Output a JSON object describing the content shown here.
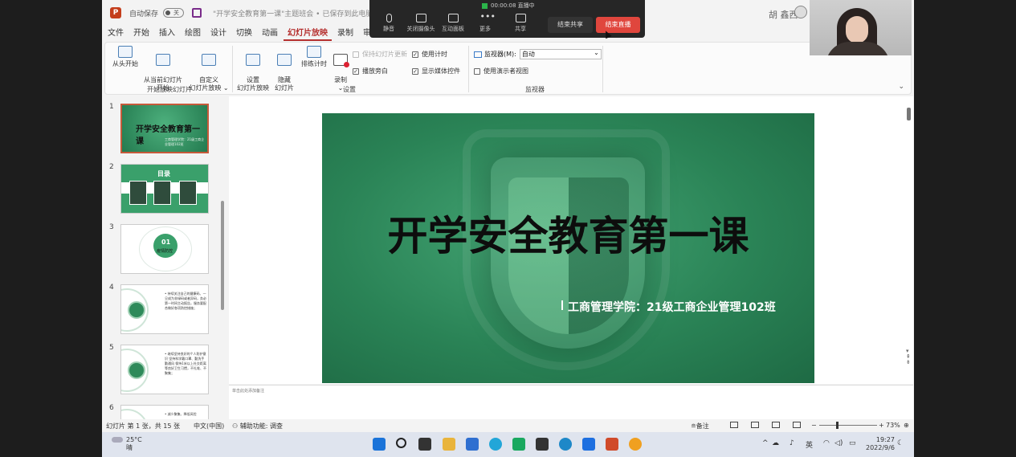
{
  "titlebar": {
    "autosave_label": "自动保存",
    "toggle_state": "关",
    "doc_title": "\"开学安全教育第一课\"主题班会 • 已保存到此电脑 ∨",
    "user_name": "胡 鑫西"
  },
  "meeting": {
    "timer": "00:00:08 直播中",
    "buttons": [
      {
        "label": "静音",
        "icon": "microphone-icon"
      },
      {
        "label": "关闭摄像头",
        "icon": "camera-icon"
      },
      {
        "label": "互动面板",
        "icon": "chat-panel-icon"
      },
      {
        "label": "更多",
        "icon": "more-dots-icon"
      },
      {
        "label": "共享",
        "icon": "share-screen-icon"
      }
    ],
    "end_share": "结束共享",
    "end_live": "结束直播"
  },
  "menu": [
    "文件",
    "开始",
    "插入",
    "绘图",
    "设计",
    "切换",
    "动画",
    "幻灯片放映",
    "录制",
    "审阅"
  ],
  "menu_active_index": 7,
  "ribbon": {
    "group1": {
      "label": "开始放映幻灯片",
      "buttons": [
        "从头开始",
        "从当前幻灯片\n开始",
        "自定义\n幻灯片放映 ⌄"
      ]
    },
    "group2": {
      "label": "设置",
      "buttons": [
        "设置\n幻灯片放映",
        "隐藏\n幻灯片",
        "排练计时",
        "录制\n⌄"
      ],
      "checkboxes": [
        {
          "label": "保持幻灯片更新",
          "checked": false,
          "disabled": true
        },
        {
          "label": "播放旁白",
          "checked": true,
          "disabled": false
        },
        {
          "label": "使用计时",
          "checked": true,
          "disabled": false
        },
        {
          "label": "显示媒体控件",
          "checked": true,
          "disabled": false
        }
      ]
    },
    "group3": {
      "label": "监视器",
      "monitor_label": "监视器(M):",
      "monitor_value": "自动",
      "presenter_view": {
        "label": "使用演示者视图",
        "checked": false
      }
    }
  },
  "thumbnails": [
    {
      "num": "1",
      "title": "开学安全教育第一课",
      "sub": "工商管理学院：21级工商企业管理102班"
    },
    {
      "num": "2",
      "title": "目录"
    },
    {
      "num": "3",
      "number": "01",
      "label": "疫情防控"
    },
    {
      "num": "4",
      "label": "1.防疫\n措施",
      "text": "• 持续关注自己的健康码、一旦成为非绿码或者异码，务必第一时间主动报告，服务要配合做好各项防控措施；"
    },
    {
      "num": "5",
      "label": "2.注意\n个人防护",
      "text": "• 继续坚持良好的个人防护意识 坚持科学戴口罩、勤洗手 勤通风 保持1米以上社交距离 等良好卫生习惯，不扎堆、不聚集；"
    },
    {
      "num": "6",
      "text": "• 减少聚集、降低风险"
    }
  ],
  "slide": {
    "title": "开学安全教育第一课",
    "subtitle": "工商管理学院：21级工商企业管理102班"
  },
  "notes_placeholder": "单击此处添加备注",
  "status": {
    "slide_info": "幻灯片 第 1 张，共 15 张",
    "language": "中文(中国)",
    "accessibility": "辅助功能: 调查",
    "notes": "备注",
    "zoom": "73%"
  },
  "taskbar": {
    "temperature": "25°C",
    "weather": "晴",
    "ime": "英",
    "time": "19:27",
    "date": "2022/9/6"
  }
}
